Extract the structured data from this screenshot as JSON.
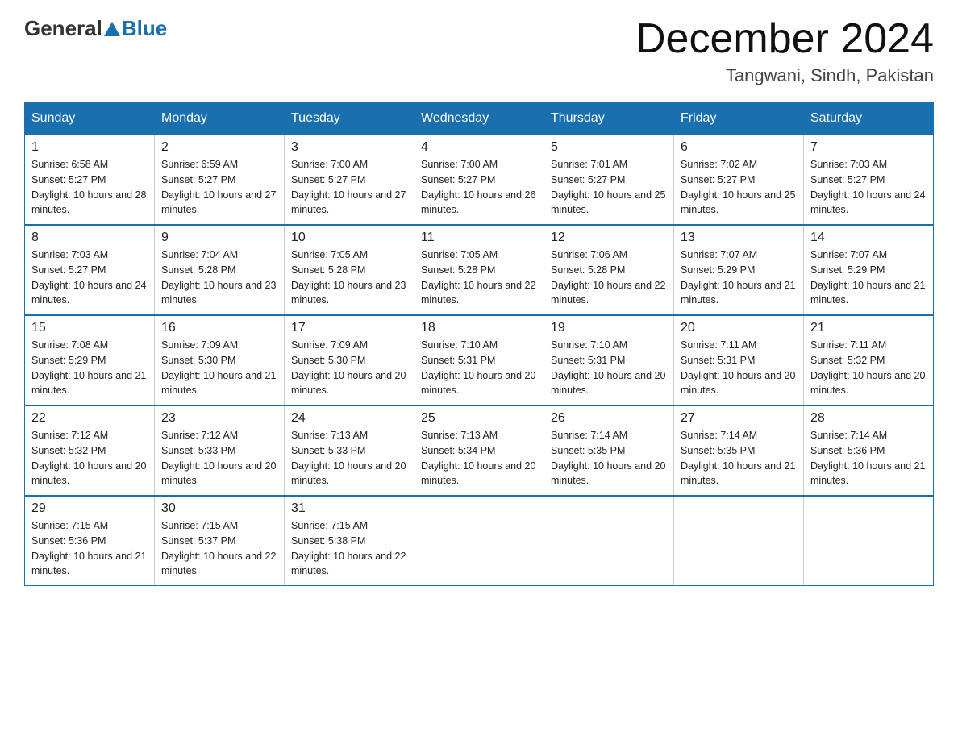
{
  "header": {
    "logo_general": "General",
    "logo_blue": "Blue",
    "title": "December 2024",
    "location": "Tangwani, Sindh, Pakistan"
  },
  "days_of_week": [
    "Sunday",
    "Monday",
    "Tuesday",
    "Wednesday",
    "Thursday",
    "Friday",
    "Saturday"
  ],
  "weeks": [
    [
      {
        "day": "1",
        "sunrise": "6:58 AM",
        "sunset": "5:27 PM",
        "daylight": "10 hours and 28 minutes"
      },
      {
        "day": "2",
        "sunrise": "6:59 AM",
        "sunset": "5:27 PM",
        "daylight": "10 hours and 27 minutes"
      },
      {
        "day": "3",
        "sunrise": "7:00 AM",
        "sunset": "5:27 PM",
        "daylight": "10 hours and 27 minutes"
      },
      {
        "day": "4",
        "sunrise": "7:00 AM",
        "sunset": "5:27 PM",
        "daylight": "10 hours and 26 minutes"
      },
      {
        "day": "5",
        "sunrise": "7:01 AM",
        "sunset": "5:27 PM",
        "daylight": "10 hours and 25 minutes"
      },
      {
        "day": "6",
        "sunrise": "7:02 AM",
        "sunset": "5:27 PM",
        "daylight": "10 hours and 25 minutes"
      },
      {
        "day": "7",
        "sunrise": "7:03 AM",
        "sunset": "5:27 PM",
        "daylight": "10 hours and 24 minutes"
      }
    ],
    [
      {
        "day": "8",
        "sunrise": "7:03 AM",
        "sunset": "5:27 PM",
        "daylight": "10 hours and 24 minutes"
      },
      {
        "day": "9",
        "sunrise": "7:04 AM",
        "sunset": "5:28 PM",
        "daylight": "10 hours and 23 minutes"
      },
      {
        "day": "10",
        "sunrise": "7:05 AM",
        "sunset": "5:28 PM",
        "daylight": "10 hours and 23 minutes"
      },
      {
        "day": "11",
        "sunrise": "7:05 AM",
        "sunset": "5:28 PM",
        "daylight": "10 hours and 22 minutes"
      },
      {
        "day": "12",
        "sunrise": "7:06 AM",
        "sunset": "5:28 PM",
        "daylight": "10 hours and 22 minutes"
      },
      {
        "day": "13",
        "sunrise": "7:07 AM",
        "sunset": "5:29 PM",
        "daylight": "10 hours and 21 minutes"
      },
      {
        "day": "14",
        "sunrise": "7:07 AM",
        "sunset": "5:29 PM",
        "daylight": "10 hours and 21 minutes"
      }
    ],
    [
      {
        "day": "15",
        "sunrise": "7:08 AM",
        "sunset": "5:29 PM",
        "daylight": "10 hours and 21 minutes"
      },
      {
        "day": "16",
        "sunrise": "7:09 AM",
        "sunset": "5:30 PM",
        "daylight": "10 hours and 21 minutes"
      },
      {
        "day": "17",
        "sunrise": "7:09 AM",
        "sunset": "5:30 PM",
        "daylight": "10 hours and 20 minutes"
      },
      {
        "day": "18",
        "sunrise": "7:10 AM",
        "sunset": "5:31 PM",
        "daylight": "10 hours and 20 minutes"
      },
      {
        "day": "19",
        "sunrise": "7:10 AM",
        "sunset": "5:31 PM",
        "daylight": "10 hours and 20 minutes"
      },
      {
        "day": "20",
        "sunrise": "7:11 AM",
        "sunset": "5:31 PM",
        "daylight": "10 hours and 20 minutes"
      },
      {
        "day": "21",
        "sunrise": "7:11 AM",
        "sunset": "5:32 PM",
        "daylight": "10 hours and 20 minutes"
      }
    ],
    [
      {
        "day": "22",
        "sunrise": "7:12 AM",
        "sunset": "5:32 PM",
        "daylight": "10 hours and 20 minutes"
      },
      {
        "day": "23",
        "sunrise": "7:12 AM",
        "sunset": "5:33 PM",
        "daylight": "10 hours and 20 minutes"
      },
      {
        "day": "24",
        "sunrise": "7:13 AM",
        "sunset": "5:33 PM",
        "daylight": "10 hours and 20 minutes"
      },
      {
        "day": "25",
        "sunrise": "7:13 AM",
        "sunset": "5:34 PM",
        "daylight": "10 hours and 20 minutes"
      },
      {
        "day": "26",
        "sunrise": "7:14 AM",
        "sunset": "5:35 PM",
        "daylight": "10 hours and 20 minutes"
      },
      {
        "day": "27",
        "sunrise": "7:14 AM",
        "sunset": "5:35 PM",
        "daylight": "10 hours and 21 minutes"
      },
      {
        "day": "28",
        "sunrise": "7:14 AM",
        "sunset": "5:36 PM",
        "daylight": "10 hours and 21 minutes"
      }
    ],
    [
      {
        "day": "29",
        "sunrise": "7:15 AM",
        "sunset": "5:36 PM",
        "daylight": "10 hours and 21 minutes"
      },
      {
        "day": "30",
        "sunrise": "7:15 AM",
        "sunset": "5:37 PM",
        "daylight": "10 hours and 22 minutes"
      },
      {
        "day": "31",
        "sunrise": "7:15 AM",
        "sunset": "5:38 PM",
        "daylight": "10 hours and 22 minutes"
      },
      null,
      null,
      null,
      null
    ]
  ]
}
